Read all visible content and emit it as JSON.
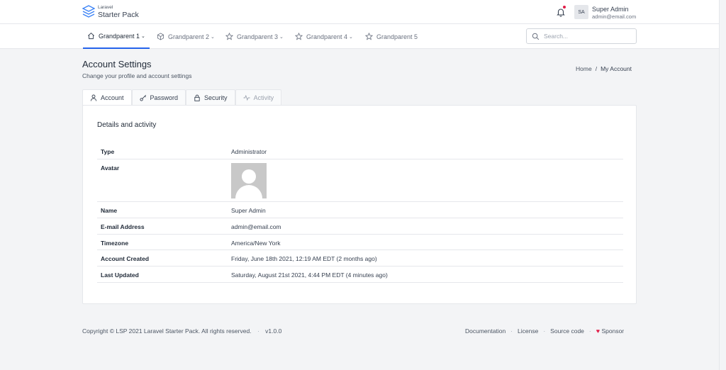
{
  "brand": {
    "line1": "Laravel",
    "line2": "Starter Pack"
  },
  "user": {
    "initials": "SA",
    "name": "Super Admin",
    "email": "admin@email.com"
  },
  "nav": {
    "items": [
      {
        "label": "Grandparent 1",
        "caret": "⌄",
        "icon": "home-icon"
      },
      {
        "label": "Grandparent 2",
        "caret": "⌄",
        "icon": "cube-icon"
      },
      {
        "label": "Grandparent 3",
        "caret": "⌄",
        "icon": "star-icon"
      },
      {
        "label": "Grandparent 4",
        "caret": "⌄",
        "icon": "star-icon"
      },
      {
        "label": "Grandparent 5",
        "caret": "",
        "icon": "star-icon"
      }
    ],
    "search_placeholder": "Search..."
  },
  "page": {
    "title": "Account Settings",
    "subtitle": "Change your profile and account settings",
    "breadcrumb": {
      "home": "Home",
      "separator": "/",
      "current": "My Account"
    }
  },
  "tabs": [
    {
      "label": "Account",
      "icon": "user-icon"
    },
    {
      "label": "Password",
      "icon": "key-icon"
    },
    {
      "label": "Security",
      "icon": "lock-icon"
    },
    {
      "label": "Activity",
      "icon": "activity-icon"
    }
  ],
  "card": {
    "title": "Details and activity",
    "rows": {
      "type": {
        "label": "Type",
        "value": "Administrator"
      },
      "avatar": {
        "label": "Avatar"
      },
      "name": {
        "label": "Name",
        "value": "Super Admin"
      },
      "email": {
        "label": "E-mail Address",
        "value": "admin@email.com"
      },
      "timezone": {
        "label": "Timezone",
        "value": "America/New York"
      },
      "created": {
        "label": "Account Created",
        "value": "Friday, June 18th 2021, 12:19 AM EDT (2 months ago)"
      },
      "updated": {
        "label": "Last Updated",
        "value": "Saturday, August 21st 2021, 4:44 PM EDT (4 minutes ago)"
      }
    }
  },
  "footer": {
    "copyright": "Copyright © LSP 2021 Laravel Starter Pack. All rights reserved.",
    "dot": "·",
    "version": "v1.0.0",
    "links": {
      "documentation": "Documentation",
      "license": "License",
      "source": "Source code",
      "sponsor": "Sponsor"
    }
  },
  "colors": {
    "accent": "#2563eb",
    "notification": "#e11d48",
    "background": "#f3f4f6"
  }
}
